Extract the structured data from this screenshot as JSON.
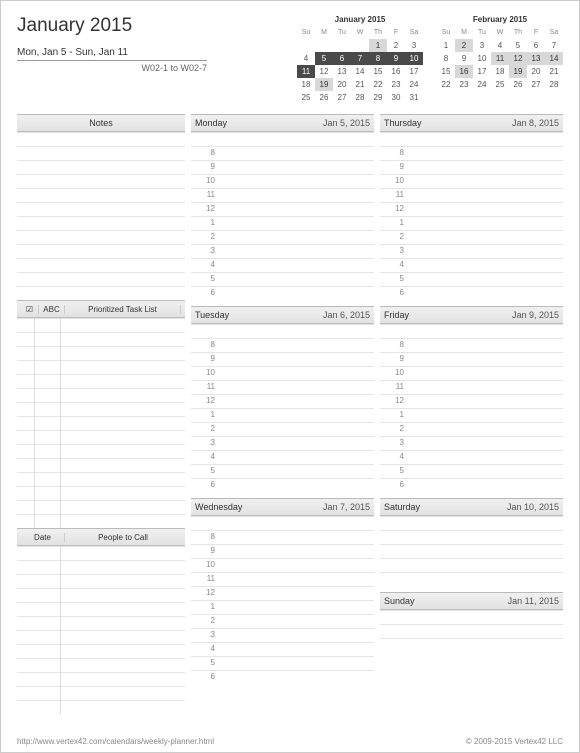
{
  "title": "January 2015",
  "week_range": "Mon, Jan 5 - Sun, Jan 11",
  "week_codes": "W02-1 to W02-7",
  "minical1": {
    "title": "January 2015",
    "dow": [
      "Su",
      "M",
      "Tu",
      "W",
      "Th",
      "F",
      "Sa"
    ],
    "rows": [
      [
        "",
        "",
        "",
        "",
        "1",
        "2",
        "3"
      ],
      [
        "4",
        "5",
        "6",
        "7",
        "8",
        "9",
        "10"
      ],
      [
        "11",
        "12",
        "13",
        "14",
        "15",
        "16",
        "17"
      ],
      [
        "18",
        "19",
        "20",
        "21",
        "22",
        "23",
        "24"
      ],
      [
        "25",
        "26",
        "27",
        "28",
        "29",
        "30",
        "31"
      ]
    ],
    "hl_row1_from": 1,
    "hl_row2_col0": true,
    "hl2_cells": [
      [
        0,
        4
      ],
      [
        3,
        1
      ]
    ]
  },
  "minical2": {
    "title": "February 2015",
    "dow": [
      "Su",
      "M",
      "Tu",
      "W",
      "Th",
      "F",
      "Sa"
    ],
    "rows": [
      [
        "1",
        "2",
        "3",
        "4",
        "5",
        "6",
        "7"
      ],
      [
        "8",
        "9",
        "10",
        "11",
        "12",
        "13",
        "14"
      ],
      [
        "15",
        "16",
        "17",
        "18",
        "19",
        "20",
        "21"
      ],
      [
        "22",
        "23",
        "24",
        "25",
        "26",
        "27",
        "28"
      ]
    ],
    "hl2_cells": [
      [
        0,
        1
      ],
      [
        1,
        3
      ],
      [
        1,
        4
      ],
      [
        1,
        5
      ],
      [
        1,
        6
      ],
      [
        2,
        1
      ],
      [
        2,
        4
      ]
    ]
  },
  "sidebar": {
    "notes_label": "Notes",
    "task_chk": "☑",
    "task_abc": "ABC",
    "task_label": "Prioritized Task List",
    "people_date": "Date",
    "people_label": "People to Call"
  },
  "hours": [
    "8",
    "9",
    "10",
    "11",
    "12",
    "1",
    "2",
    "3",
    "4",
    "5",
    "6"
  ],
  "days": {
    "mon": {
      "label": "Monday",
      "date": "Jan 5, 2015"
    },
    "tue": {
      "label": "Tuesday",
      "date": "Jan 6, 2015"
    },
    "wed": {
      "label": "Wednesday",
      "date": "Jan 7, 2015"
    },
    "thu": {
      "label": "Thursday",
      "date": "Jan 8, 2015"
    },
    "fri": {
      "label": "Friday",
      "date": "Jan 9, 2015"
    },
    "sat": {
      "label": "Saturday",
      "date": "Jan 10, 2015"
    },
    "sun": {
      "label": "Sunday",
      "date": "Jan 11, 2015"
    }
  },
  "footer": {
    "url": "http://www.vertex42.com/calendars/weekly-planner.html",
    "copyright": "© 2009-2015 Vertex42 LLC"
  }
}
